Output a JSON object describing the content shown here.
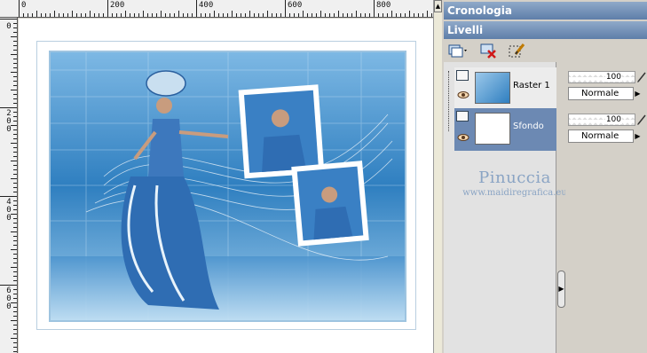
{
  "ruler": {
    "top_labels": [
      "0",
      "200",
      "400",
      "600",
      "800"
    ],
    "left_labels": [
      "0",
      "2\n0\n0",
      "4\n0\n0",
      "6\n0\n0"
    ]
  },
  "panels": {
    "history_title": "Cronologia",
    "layers_title": "Livelli"
  },
  "layers": [
    {
      "name": "Raster 1",
      "opacity": "100",
      "blend": "Normale",
      "selected": false
    },
    {
      "name": "Sfondo",
      "opacity": "100",
      "blend": "Normale",
      "selected": true
    }
  ],
  "watermark": {
    "name": "Pinuccia",
    "url": "www.maidiregrafica.eu"
  },
  "toolbar_icons": [
    "new-layer-icon",
    "delete-layer-icon",
    "edit-layer-icon"
  ],
  "colors": {
    "title_bar": "#5e7ea9",
    "selected_row": "#6c89b3",
    "watermark": "#8aa4c4"
  }
}
